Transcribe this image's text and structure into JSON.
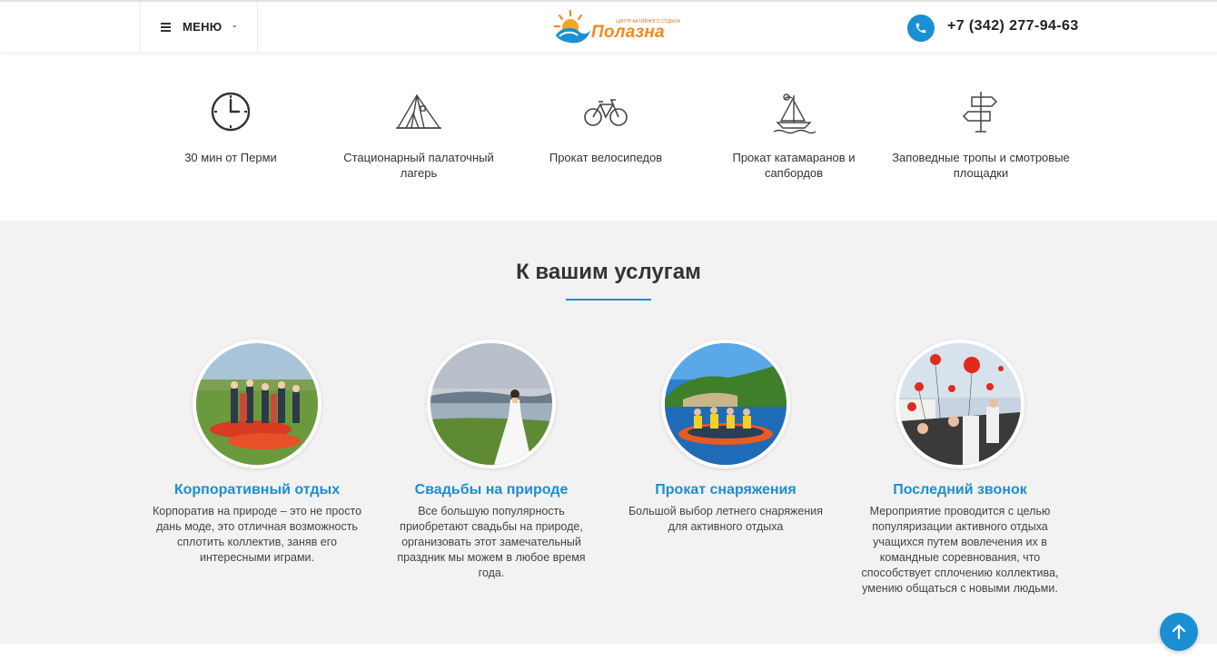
{
  "header": {
    "menu_label": "МЕНЮ",
    "logo_word": "Полазна",
    "logo_subtitle": "ЦЕНТР АКТИВНОГО ОТДЫХА",
    "phone": "+7 (342) 277-94-63"
  },
  "features": [
    {
      "icon": "clock-icon",
      "text": "30 мин от Перми"
    },
    {
      "icon": "tent-icon",
      "text": "Стационарный палаточный лагерь"
    },
    {
      "icon": "bicycle-icon",
      "text": "Прокат велосипедов"
    },
    {
      "icon": "sailboat-icon",
      "text": "Прокат катамаранов и сапбордов"
    },
    {
      "icon": "signpost-icon",
      "text": "Заповедные тропы и смотровые площадки"
    }
  ],
  "services": {
    "title": "К вашим услугам",
    "cards": [
      {
        "title": "Корпоративный отдых",
        "text": "Корпоратив на природе – это не просто дань моде, это отличная возможность сплотить коллектив, заняв его интересными играми."
      },
      {
        "title": "Свадьбы на природе",
        "text": "Все большую популярность приобретают свадьбы на природе, организовать этот замечательный праздник мы можем в любое время года."
      },
      {
        "title": "Прокат снаряжения",
        "text": "Большой выбор летнего снаряжения для активного отдыха"
      },
      {
        "title": "Последний звонок",
        "text": "Мероприятие проводится с целью популяризации активного отдыха учащихся путем вовлечения их в командные соревнования, что способствует сплочению коллектива, умению общаться с новыми людьми."
      }
    ]
  },
  "colors": {
    "accent": "#1a8fd4",
    "logo_orange": "#f28a1e",
    "section_bg": "#f2f2f2"
  }
}
